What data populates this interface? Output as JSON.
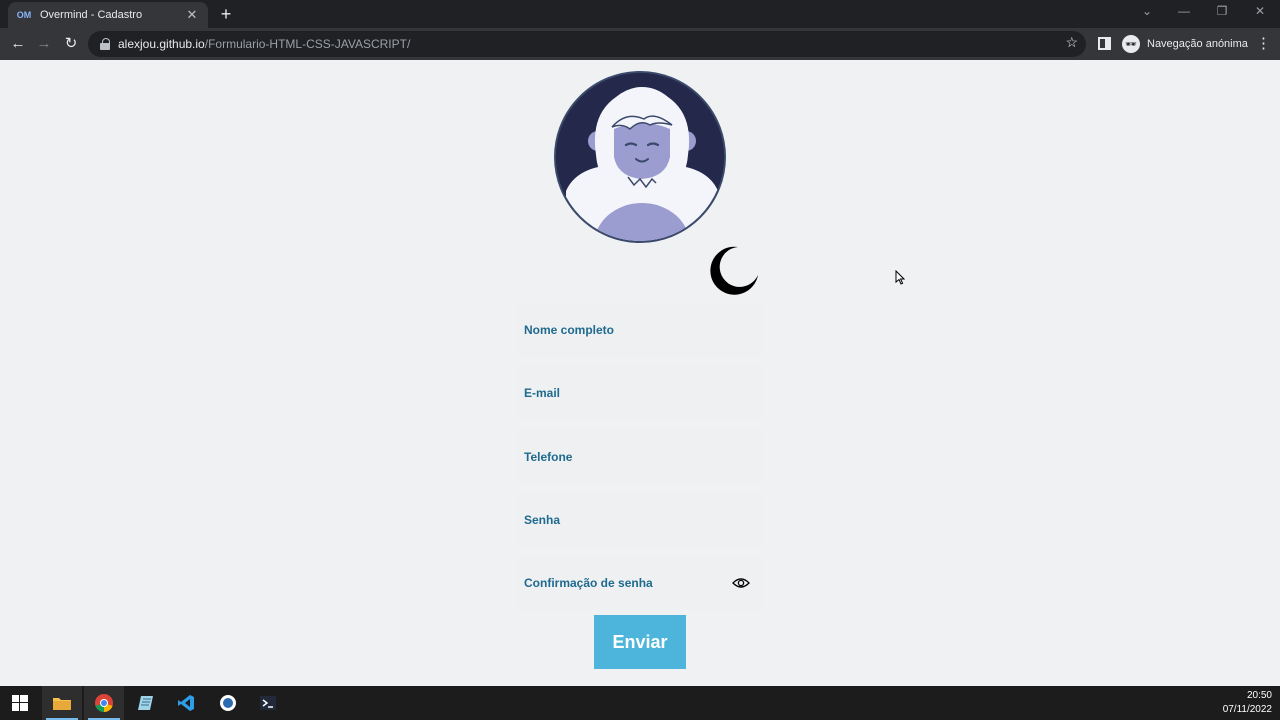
{
  "browser": {
    "tab_title": "Overmind - Cadastro",
    "tab_favicon": "OM",
    "url_host": "alexjou.github.io",
    "url_path": "/Formulario-HTML-CSS-JAVASCRIPT/",
    "incognito_label": "Navegação anónima"
  },
  "form": {
    "fields": [
      {
        "label": "Nome completo"
      },
      {
        "label": "E-mail"
      },
      {
        "label": "Telefone"
      },
      {
        "label": "Senha"
      },
      {
        "label": "Confirmação de senha"
      }
    ],
    "submit_label": "Enviar"
  },
  "colors": {
    "accent": "#4db5dc",
    "label": "#1f6a8e",
    "page_bg": "#f0f1f3"
  },
  "taskbar": {
    "apps": [
      "windows-start-icon",
      "file-explorer-icon",
      "chrome-icon",
      "notepad-icon",
      "vscode-icon",
      "app-icon",
      "terminal-icon"
    ],
    "time": "20:50",
    "date": "07/11/2022"
  }
}
